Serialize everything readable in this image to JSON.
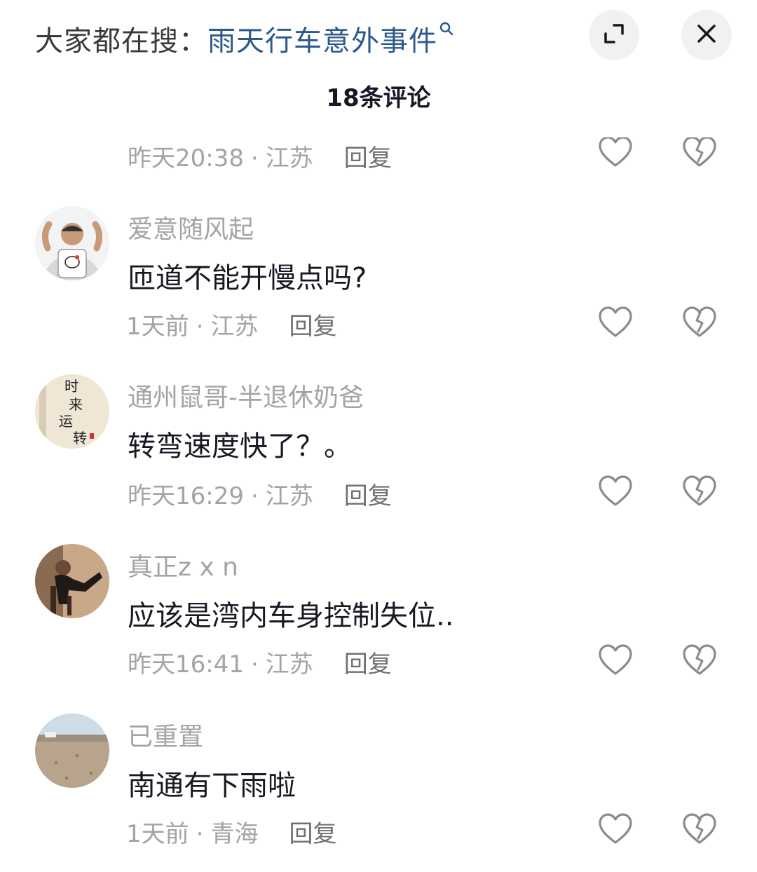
{
  "header": {
    "search_prefix": "大家都在搜：",
    "search_term": "雨天行车意外事件"
  },
  "comments_count": "18条评论",
  "partial_comment": {
    "time": "昨天20:38",
    "location": "江苏",
    "reply": "回复"
  },
  "comments": [
    {
      "username": "爱意随风起",
      "text": "匝道不能开慢点吗?",
      "time": "1天前",
      "location": "江苏",
      "reply": "回复"
    },
    {
      "username": "通州鼠哥-半退休奶爸",
      "text": "转弯速度快了？。",
      "time": "昨天16:29",
      "location": "江苏",
      "reply": "回复",
      "avatar_text": [
        "时",
        "来",
        "运",
        "转"
      ]
    },
    {
      "username": "真正z x n",
      "text": "应该是湾内车身控制失位..",
      "time": "昨天16:41",
      "location": "江苏",
      "reply": "回复"
    },
    {
      "username": "已重置",
      "text": "南通有下雨啦",
      "time": "1天前",
      "location": "青海",
      "reply": "回复"
    }
  ],
  "colors": {
    "search_term": "#2d5a8c",
    "meta_text": "#a3a3a8",
    "content_text": "#161823",
    "icon_stroke": "#8a8a8f"
  },
  "icons": {
    "search": "search-icon",
    "expand": "expand-icon",
    "close": "close-icon",
    "like": "heart-icon",
    "dislike": "broken-heart-icon"
  }
}
